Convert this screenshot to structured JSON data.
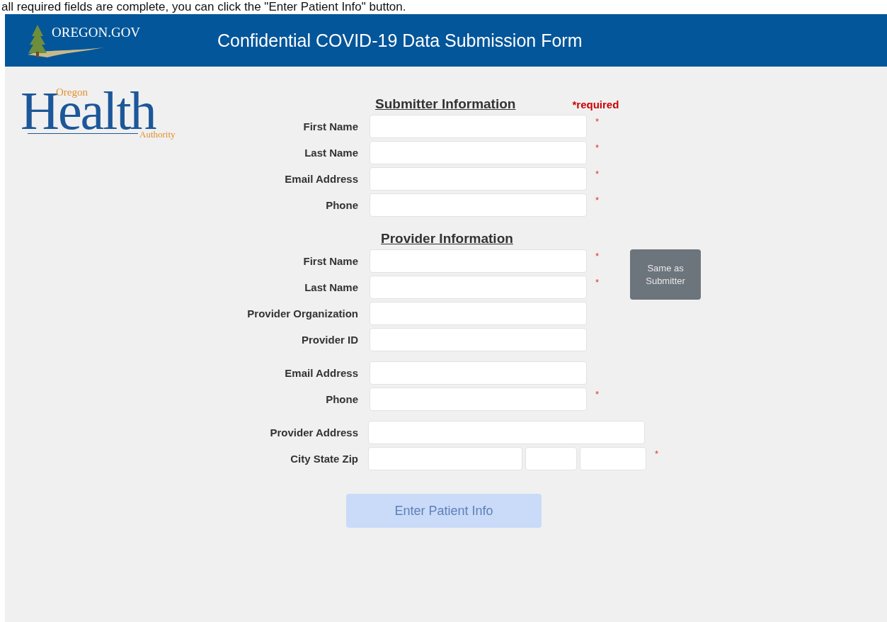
{
  "caption": "all required fields are complete, you can click the \"Enter Patient Info\" button.",
  "header": {
    "logo_text": "OREGON.GOV",
    "title": "Confidential COVID-19 Data Submission Form"
  },
  "agency_logo": {
    "top": "Oregon",
    "main": "Health",
    "bottom": "Authority"
  },
  "required_note": "*required",
  "sections": [
    {
      "heading": "Submitter Information",
      "groups": [
        [
          {
            "label": "First Name",
            "kind": "text",
            "mark": "*"
          },
          {
            "label": "Last Name",
            "kind": "text",
            "mark": "*"
          },
          {
            "label": "Email Address",
            "kind": "text",
            "mark": "*"
          },
          {
            "label": "Phone",
            "kind": "text",
            "mark": "*"
          }
        ]
      ]
    },
    {
      "heading": "Provider Information",
      "groups": [
        [
          {
            "label": "First Name",
            "kind": "text",
            "mark": "*"
          },
          {
            "label": "Last Name",
            "kind": "text",
            "mark": "*"
          },
          {
            "label": "Provider Organization",
            "kind": "text"
          },
          {
            "label": "Provider ID",
            "kind": "text"
          }
        ],
        [
          {
            "label": "Email Address",
            "kind": "text"
          },
          {
            "label": "Phone",
            "kind": "text",
            "mark": "*"
          }
        ],
        [
          {
            "label": "Provider Address",
            "kind": "wide"
          },
          {
            "label": "City State Zip",
            "kind": "city_state_zip",
            "mark": "*"
          }
        ]
      ]
    }
  ],
  "same_as_button": {
    "label": "Same as Submitter"
  },
  "submit_button": {
    "label": "Enter Patient Info",
    "disabled": true
  }
}
